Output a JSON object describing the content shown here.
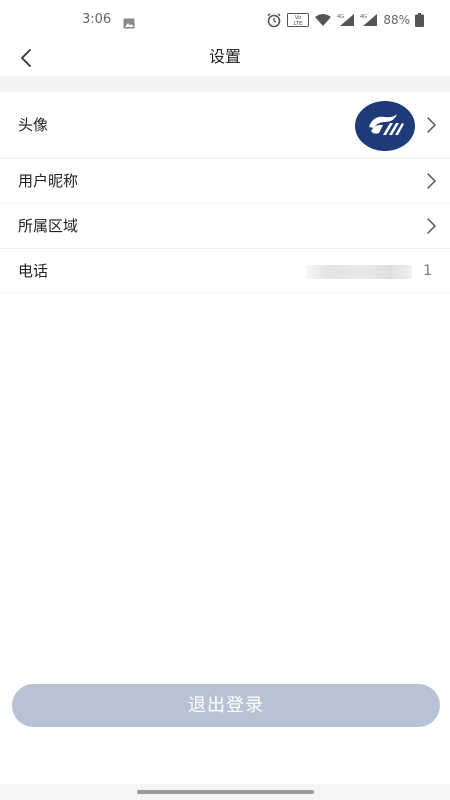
{
  "status_bar": {
    "time": "3:06",
    "battery": "88%",
    "network_badge": "4G",
    "volte": "Vo LTE"
  },
  "header": {
    "title": "设置"
  },
  "settings": {
    "avatar_label": "头像",
    "nickname_label": "用户昵称",
    "region_label": "所属区域",
    "phone_label": "电话",
    "phone_visible_suffix": "1"
  },
  "logout": {
    "label": "退出登录"
  },
  "colors": {
    "logout_bg": "#b7c2d3",
    "avatar_bg": "#1f3a78",
    "separator": "#efefef",
    "band": "#f4f4f6"
  }
}
